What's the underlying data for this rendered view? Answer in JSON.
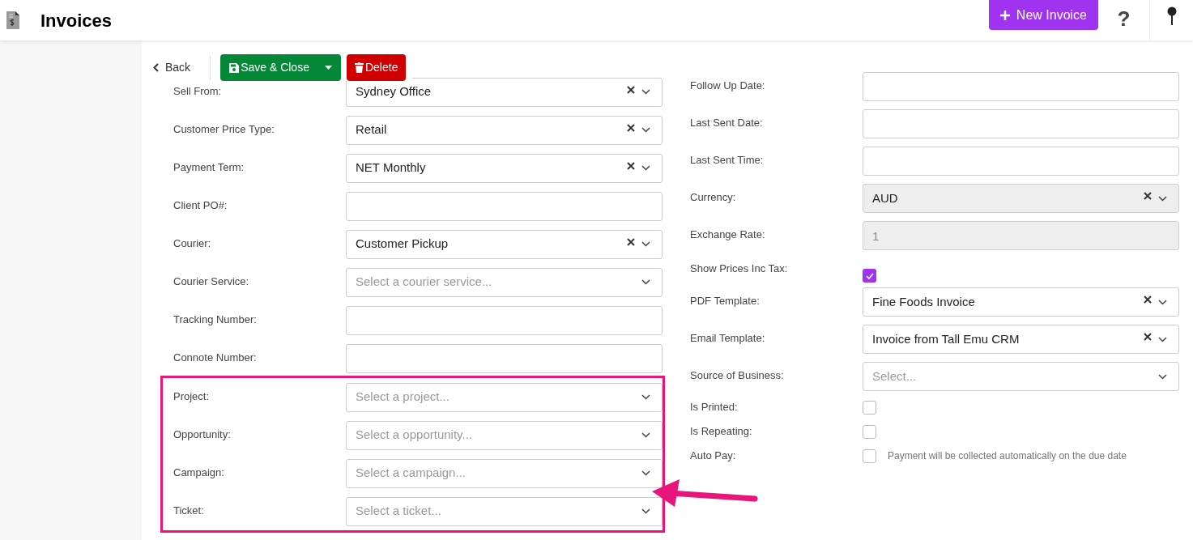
{
  "header": {
    "title": "Invoices",
    "new_button": "New Invoice",
    "help": "?"
  },
  "toolbar": {
    "back": "Back",
    "save": "Save & Close",
    "delete": "Delete"
  },
  "left_fields": [
    {
      "label": "Sell From:",
      "kind": "select",
      "value": "Sydney Office"
    },
    {
      "label": "Customer Price Type:",
      "kind": "select",
      "value": "Retail"
    },
    {
      "label": "Payment Term:",
      "kind": "select",
      "value": "NET Monthly"
    },
    {
      "label": "Client PO#:",
      "kind": "text"
    },
    {
      "label": "Courier:",
      "kind": "select",
      "value": "Customer Pickup"
    },
    {
      "label": "Courier Service:",
      "kind": "select",
      "placeholder": "Select a courier service..."
    },
    {
      "label": "Tracking Number:",
      "kind": "text"
    },
    {
      "label": "Connote Number:",
      "kind": "text"
    }
  ],
  "highlighted_fields": [
    {
      "label": "Project:",
      "kind": "select",
      "placeholder": "Select a project..."
    },
    {
      "label": "Opportunity:",
      "kind": "select",
      "placeholder": "Select a opportunity..."
    },
    {
      "label": "Campaign:",
      "kind": "select",
      "placeholder": "Select a campaign..."
    },
    {
      "label": "Ticket:",
      "kind": "select",
      "placeholder": "Select a ticket..."
    }
  ],
  "right_fields": [
    {
      "label": "Follow Up Date:",
      "kind": "text",
      "disabled": false
    },
    {
      "label": "Last Sent Date:",
      "kind": "text",
      "disabled": false
    },
    {
      "label": "Last Sent Time:",
      "kind": "text",
      "disabled": false
    },
    {
      "label": "Currency:",
      "kind": "select",
      "value": "AUD",
      "disabled": true
    },
    {
      "label": "Exchange Rate:",
      "kind": "text",
      "value": "1",
      "disabled": true
    },
    {
      "label": "Show Prices Inc Tax:",
      "kind": "checkbox",
      "checked": true
    },
    {
      "label": "PDF Template:",
      "kind": "select",
      "value": "Fine Foods Invoice",
      "disabled": false
    },
    {
      "label": "Email Template:",
      "kind": "select",
      "value": "Invoice from Tall Emu CRM",
      "disabled": false
    },
    {
      "label": "Source of Business:",
      "kind": "select",
      "placeholder": "Select...",
      "disabled": false
    },
    {
      "label": "Is Printed:",
      "kind": "checkbox",
      "checked": false
    },
    {
      "label": "Is Repeating:",
      "kind": "checkbox",
      "checked": false
    },
    {
      "label": "Auto Pay:",
      "kind": "checkbox",
      "checked": false,
      "note": "Payment will be collected automatically on the due date"
    }
  ]
}
